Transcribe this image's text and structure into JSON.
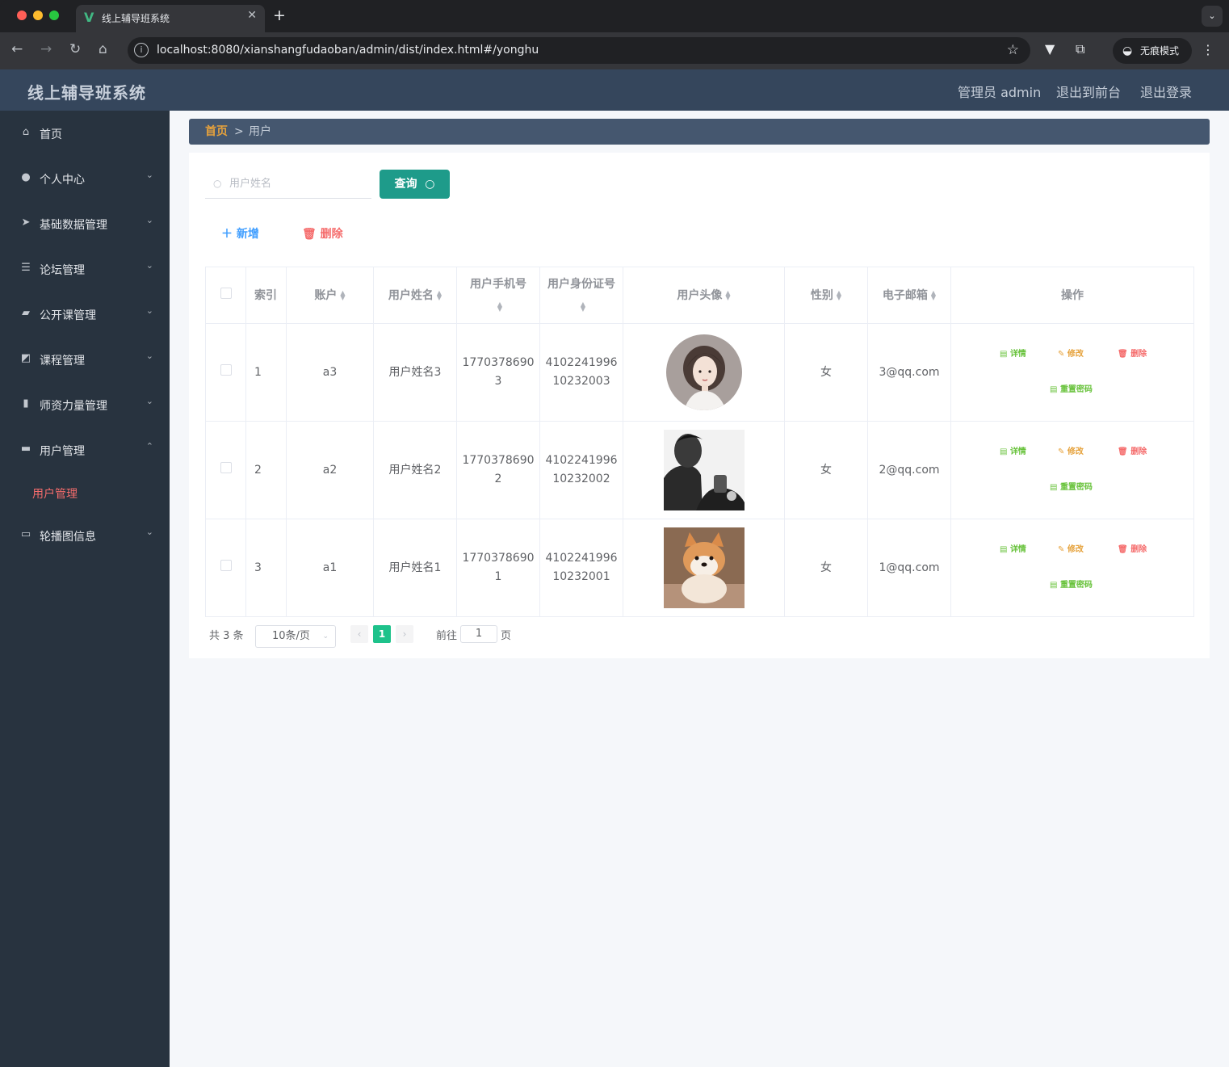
{
  "browser": {
    "tab_title": "线上辅导班系统",
    "tab_logo": "V",
    "url": "localhost:8080/xianshangfudaoban/admin/dist/index.html#/yonghu",
    "incognito_label": "无痕模式"
  },
  "header": {
    "brand": "线上辅导班系统",
    "admin_label": "管理员 admin",
    "to_front_label": "退出到前台",
    "logout_label": "退出登录"
  },
  "sidebar": {
    "items": [
      {
        "label": "首页",
        "icon": "home-icon"
      },
      {
        "label": "个人中心",
        "icon": "user-icon"
      },
      {
        "label": "基础数据管理",
        "icon": "paper-plane-icon"
      },
      {
        "label": "论坛管理",
        "icon": "list-icon"
      },
      {
        "label": "公开课管理",
        "icon": "ticket-icon"
      },
      {
        "label": "课程管理",
        "icon": "chart-icon"
      },
      {
        "label": "师资力量管理",
        "icon": "bar-chart-icon"
      },
      {
        "label": "用户管理",
        "icon": "inbox-icon"
      },
      {
        "label": "轮播图信息",
        "icon": "picture-icon"
      }
    ],
    "active_sub": "用户管理"
  },
  "breadcrumb": {
    "home": "首页",
    "sep": ">",
    "current": "用户"
  },
  "search": {
    "placeholder": "用户姓名",
    "query_label": "查询"
  },
  "actions": {
    "add_label": "新增",
    "delete_label": "删除"
  },
  "table": {
    "headers": {
      "index": "索引",
      "account": "账户",
      "name": "用户姓名",
      "phone": "用户手机号",
      "idcard": "用户身份证号",
      "avatar": "用户头像",
      "gender": "性别",
      "email": "电子邮箱",
      "ops": "操作"
    },
    "rows": [
      {
        "index": "1",
        "account": "a3",
        "name": "用户姓名3",
        "phone_l1": "1770378690",
        "phone_l2": "3",
        "id_l1": "4102241996",
        "id_l2": "10232003",
        "gender": "女",
        "email": "3@qq.com"
      },
      {
        "index": "2",
        "account": "a2",
        "name": "用户姓名2",
        "phone_l1": "1770378690",
        "phone_l2": "2",
        "id_l1": "4102241996",
        "id_l2": "10232002",
        "gender": "女",
        "email": "2@qq.com"
      },
      {
        "index": "3",
        "account": "a1",
        "name": "用户姓名1",
        "phone_l1": "1770378690",
        "phone_l2": "1",
        "id_l1": "4102241996",
        "id_l2": "10232001",
        "gender": "女",
        "email": "1@qq.com"
      }
    ],
    "op_labels": {
      "detail": "详情",
      "edit": "修改",
      "delete": "删除",
      "reset": "重置密码"
    }
  },
  "pager": {
    "total": "共 3 条",
    "page_size": "10条/页",
    "current": "1",
    "goto_label": "前往",
    "goto_value": "1",
    "page_suffix": "页"
  },
  "colors": {
    "accent": "#1e9b8a",
    "active_menu": "#f56c6c",
    "header": "#35465c",
    "sidebar": "#28333f"
  }
}
